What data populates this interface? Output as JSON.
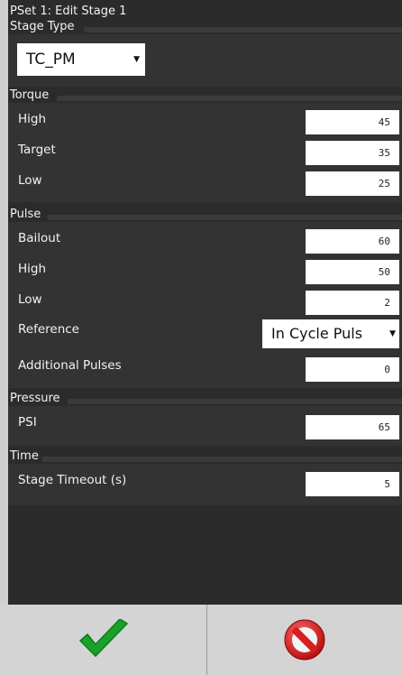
{
  "window": {
    "title": "PSet 1: Edit Stage 1"
  },
  "stage_type": {
    "header": "Stage Type",
    "value": "TC_PM"
  },
  "torque": {
    "header": "Torque",
    "high_label": "High",
    "high_value": "45",
    "target_label": "Target",
    "target_value": "35",
    "low_label": "Low",
    "low_value": "25"
  },
  "pulse": {
    "header": "Pulse",
    "bailout_label": "Bailout",
    "bailout_value": "60",
    "high_label": "High",
    "high_value": "50",
    "low_label": "Low",
    "low_value": "2",
    "reference_label": "Reference",
    "reference_value": "In Cycle Puls",
    "additional_label": "Additional Pulses",
    "additional_value": "0"
  },
  "pressure": {
    "header": "Pressure",
    "psi_label": "PSI",
    "psi_value": "65"
  },
  "time": {
    "header": "Time",
    "timeout_label": "Stage Timeout (s)",
    "timeout_value": "5"
  },
  "footer": {
    "accept_icon": "checkmark-icon",
    "cancel_icon": "no-entry-icon"
  },
  "colors": {
    "accept": "#1aa12a",
    "cancel": "#d61f1f",
    "panel": "#2b2b2b"
  }
}
